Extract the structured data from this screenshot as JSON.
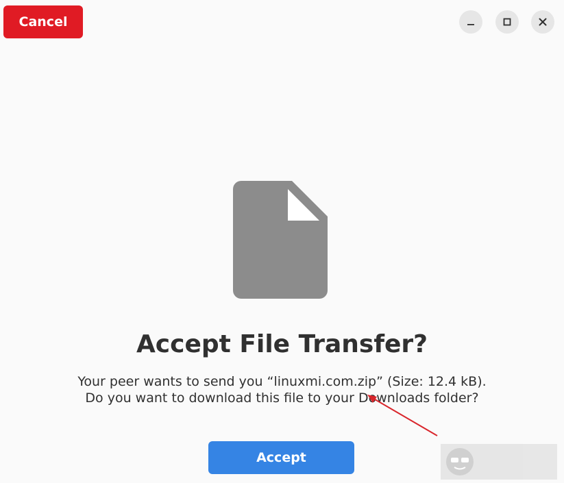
{
  "header": {
    "cancel_label": "Cancel",
    "window_controls": {
      "minimize_icon": "minimize-icon",
      "maximize_icon": "maximize-icon",
      "close_icon": "close-icon"
    }
  },
  "main": {
    "icon": "file-icon",
    "title": "Accept File Transfer?",
    "message_line1": "Your peer wants to send you “linuxmi.com.zip” (Size: 12.4 kB).",
    "message_line2": "Do you want to download this file to your Downloads folder?",
    "accept_label": "Accept"
  },
  "colors": {
    "cancel": "#e01b24",
    "accept": "#3584e4",
    "annotation_arrow": "#d9262c",
    "icon_gray": "#8c8c8c"
  }
}
